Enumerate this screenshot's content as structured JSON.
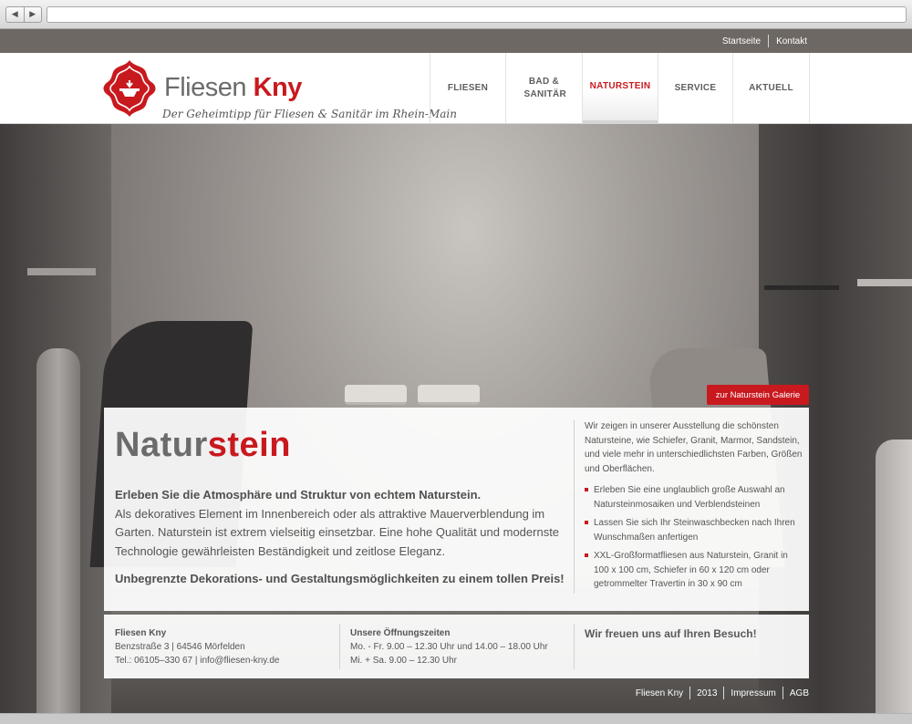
{
  "browser": {
    "back_icon": "back-arrow-icon",
    "forward_icon": "forward-arrow-icon",
    "url": ""
  },
  "topbar": {
    "links": [
      "Startseite",
      "Kontakt"
    ]
  },
  "logo": {
    "name_part1": "Fliesen",
    "name_part2": "Kny",
    "tagline": "Der Geheimtipp für Fliesen & Sanitär im Rhein-Main",
    "icon": "logo-ornament-icon",
    "brand_color": "#c8191f"
  },
  "nav": {
    "items": [
      {
        "label": "FLIESEN"
      },
      {
        "label": "BAD & SANITÄR"
      },
      {
        "label": "NATURSTEIN"
      },
      {
        "label": "SERVICE"
      },
      {
        "label": "AKTUELL"
      }
    ],
    "active": "NATURSTEIN"
  },
  "gallery_button": "zur Naturstein Galerie",
  "panel": {
    "title_part1": "Natur",
    "title_part2": "stein",
    "lead": "Erleben Sie die Atmosphäre und Struktur von echtem Naturstein.",
    "body": "Als dekoratives Element im Innenbereich oder als attraktive Mauerverblendung im Garten. Naturstein ist extrem vielseitig einsetzbar. Eine hohe Qualität und modernste Technologie gewährleisten Beständigkeit und zeitlose Eleganz.",
    "closing": "Unbegrenzte Dekorations- und Gestaltungsmöglichkeiten zu einem tollen Preis!",
    "side_intro": "Wir zeigen in unserer Ausstellung die schönsten Natursteine, wie Schiefer, Granit, Marmor, Sandstein, und viele mehr in unterschiedlichsten Farben, Größen und Oberflächen.",
    "bullets": [
      "Erleben Sie eine unglaublich große Auswahl an Natursteinmosaiken und Verblendsteinen",
      "Lassen Sie sich Ihr Steinwaschbecken nach Ihren Wunschmaßen anfertigen",
      "XXL-Großformatfliesen aus Naturstein, Granit in 100 x 100 cm, Schiefer in 60 x 120 cm oder getrommelter Travertin in 30 x 90 cm"
    ]
  },
  "info": {
    "company": "Fliesen Kny",
    "address": "Benzstraße 3 | 64546 Mörfelden",
    "contact": "Tel.: 06105–330 67 | info@fliesen-kny.de",
    "hours_title": "Unsere Öffnungszeiten",
    "hours_weekday": "Mo. - Fr. 9.00 – 12.30 Uhr und 14.00 – 18.00 Uhr",
    "hours_saturday": "Mi. + Sa. 9.00 – 12.30 Uhr",
    "welcome": "Wir freuen uns auf Ihren Besuch!"
  },
  "footer": {
    "links": [
      "Fliesen Kny",
      "2013",
      "Impressum",
      "AGB"
    ]
  }
}
